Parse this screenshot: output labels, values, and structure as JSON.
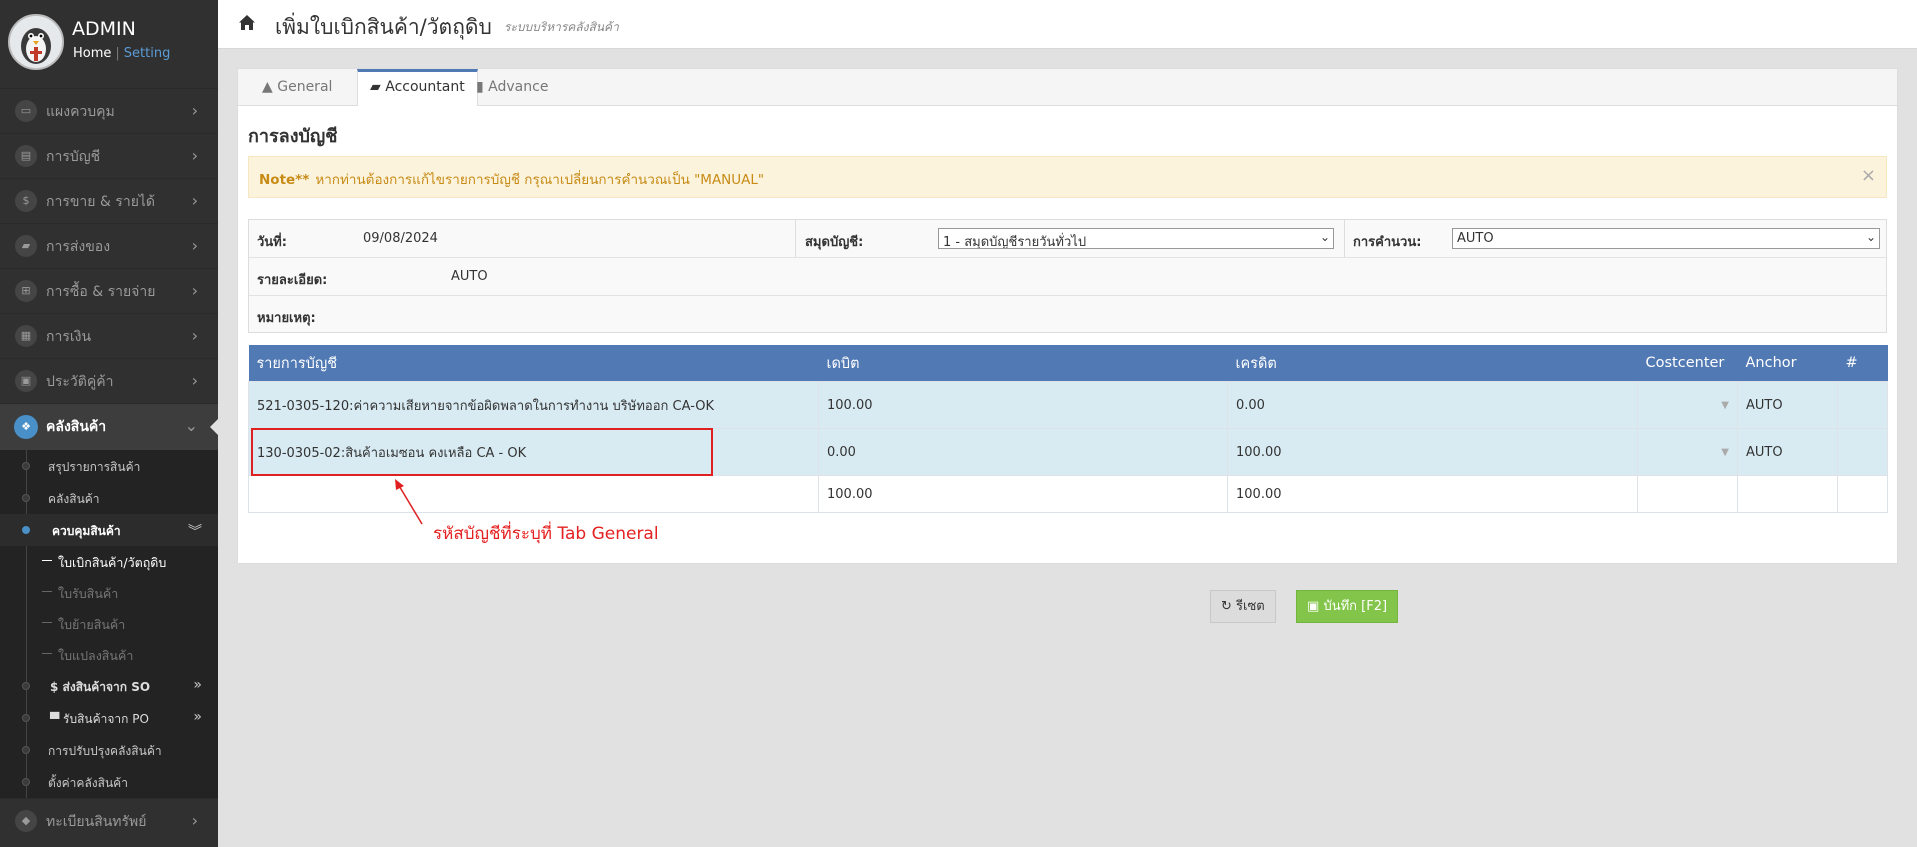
{
  "sidebar": {
    "admin_name": "ADMIN",
    "home_link": "Home",
    "separator": "|",
    "setting_link": "Setting",
    "menu": [
      {
        "label": "แผงควบคุม",
        "icon": "monitor-icon"
      },
      {
        "label": "การบัญชี",
        "icon": "book-icon"
      },
      {
        "label": "การขาย & รายได้",
        "icon": "dollar-icon"
      },
      {
        "label": "การส่งของ",
        "icon": "truck-icon"
      },
      {
        "label": "การซื้อ & รายจ่าย",
        "icon": "cart-icon"
      },
      {
        "label": "การเงิน",
        "icon": "calendar-icon"
      },
      {
        "label": "ประวัติคู่ค้า",
        "icon": "contact-icon"
      }
    ],
    "active_menu": {
      "label": "คลังสินค้า",
      "icon": "cubes-icon"
    },
    "submenu": [
      {
        "label": "สรุปรายการสินค้า"
      },
      {
        "label": "คลังสินค้า"
      }
    ],
    "open_submenu": {
      "label": "ควบคุมสินค้า",
      "chevron": "»"
    },
    "sub_submenu": [
      {
        "label": "ใบเบิกสินค้า/วัตถุดิบ"
      },
      {
        "label": "ใบรับสินค้า"
      },
      {
        "label": "ใบย้ายสินค้า"
      },
      {
        "label": "ใบแปลงสินค้า"
      }
    ],
    "submenu_after": [
      {
        "label": "$ ส่งสินค้าจาก SO",
        "chevron": "»"
      },
      {
        "label": "รับสินค้าจาก PO",
        "chevron": "»"
      },
      {
        "label": "การปรับปรุงคลังสินค้า"
      },
      {
        "label": "ตั้งค่าคลังสินค้า"
      }
    ],
    "bottom_menu": {
      "label": "ทะเบียนสินทรัพย์",
      "icon": "diamond-icon"
    }
  },
  "header": {
    "title": "เพิ่มใบเบิกสินค้า/วัตถุดิบ",
    "subtitle": "ระบบบริหารคลังสินค้า"
  },
  "tabs": [
    {
      "label": "General",
      "icon": "user-icon"
    },
    {
      "label": "Accountant",
      "icon": "graduation-cap-icon"
    },
    {
      "label": "Advance",
      "icon": "info-icon"
    }
  ],
  "section_title": "การลงบัญชี",
  "alert": {
    "prefix": "Note**",
    "text": "หากท่านต้องการแก้ไขรายการบัญชี กรุณาเปลี่ยนการคำนวณเป็น \"MANUAL\"",
    "close": "×"
  },
  "form": {
    "date_label": "วันที่:",
    "date_value": "09/08/2024",
    "journal_label": "สมุดบัญชี:",
    "journal_value": "1 - สมุดบัญชีรายวันทั่วไป",
    "calc_label": "การคำนวน:",
    "calc_value": "AUTO",
    "detail_label": "รายละเอียด:",
    "detail_value": "AUTO",
    "note_label": "หมายเหตุ:"
  },
  "table": {
    "headers": [
      "รายการบัญชี",
      "เดบิต",
      "เครดิต",
      "Costcenter",
      "Anchor",
      "#"
    ],
    "rows": [
      {
        "account": "521-0305-120:ค่าความเสียหายจากข้อผิดพลาดในการทำงาน บริษัทออก CA-OK",
        "debit": "100.00",
        "credit": "0.00",
        "costcenter": "",
        "anchor": "AUTO"
      },
      {
        "account": "130-0305-02:สินค้าอเมซอน คงเหลือ CA - OK",
        "debit": "0.00",
        "credit": "100.00",
        "costcenter": "",
        "anchor": "AUTO"
      }
    ],
    "totals": {
      "debit": "100.00",
      "credit": "100.00"
    }
  },
  "annotation": {
    "text": "รหัสบัญชีที่ระบุที่ Tab General",
    "color": "#e52020"
  },
  "buttons": {
    "reset": "รีเซต",
    "save": "บันทึก [F2]"
  },
  "colors": {
    "table_header": "#5179b3",
    "row_highlight": "#d8ebf3",
    "save_button": "#82c54a",
    "alert_bg": "#fcf3dd"
  }
}
